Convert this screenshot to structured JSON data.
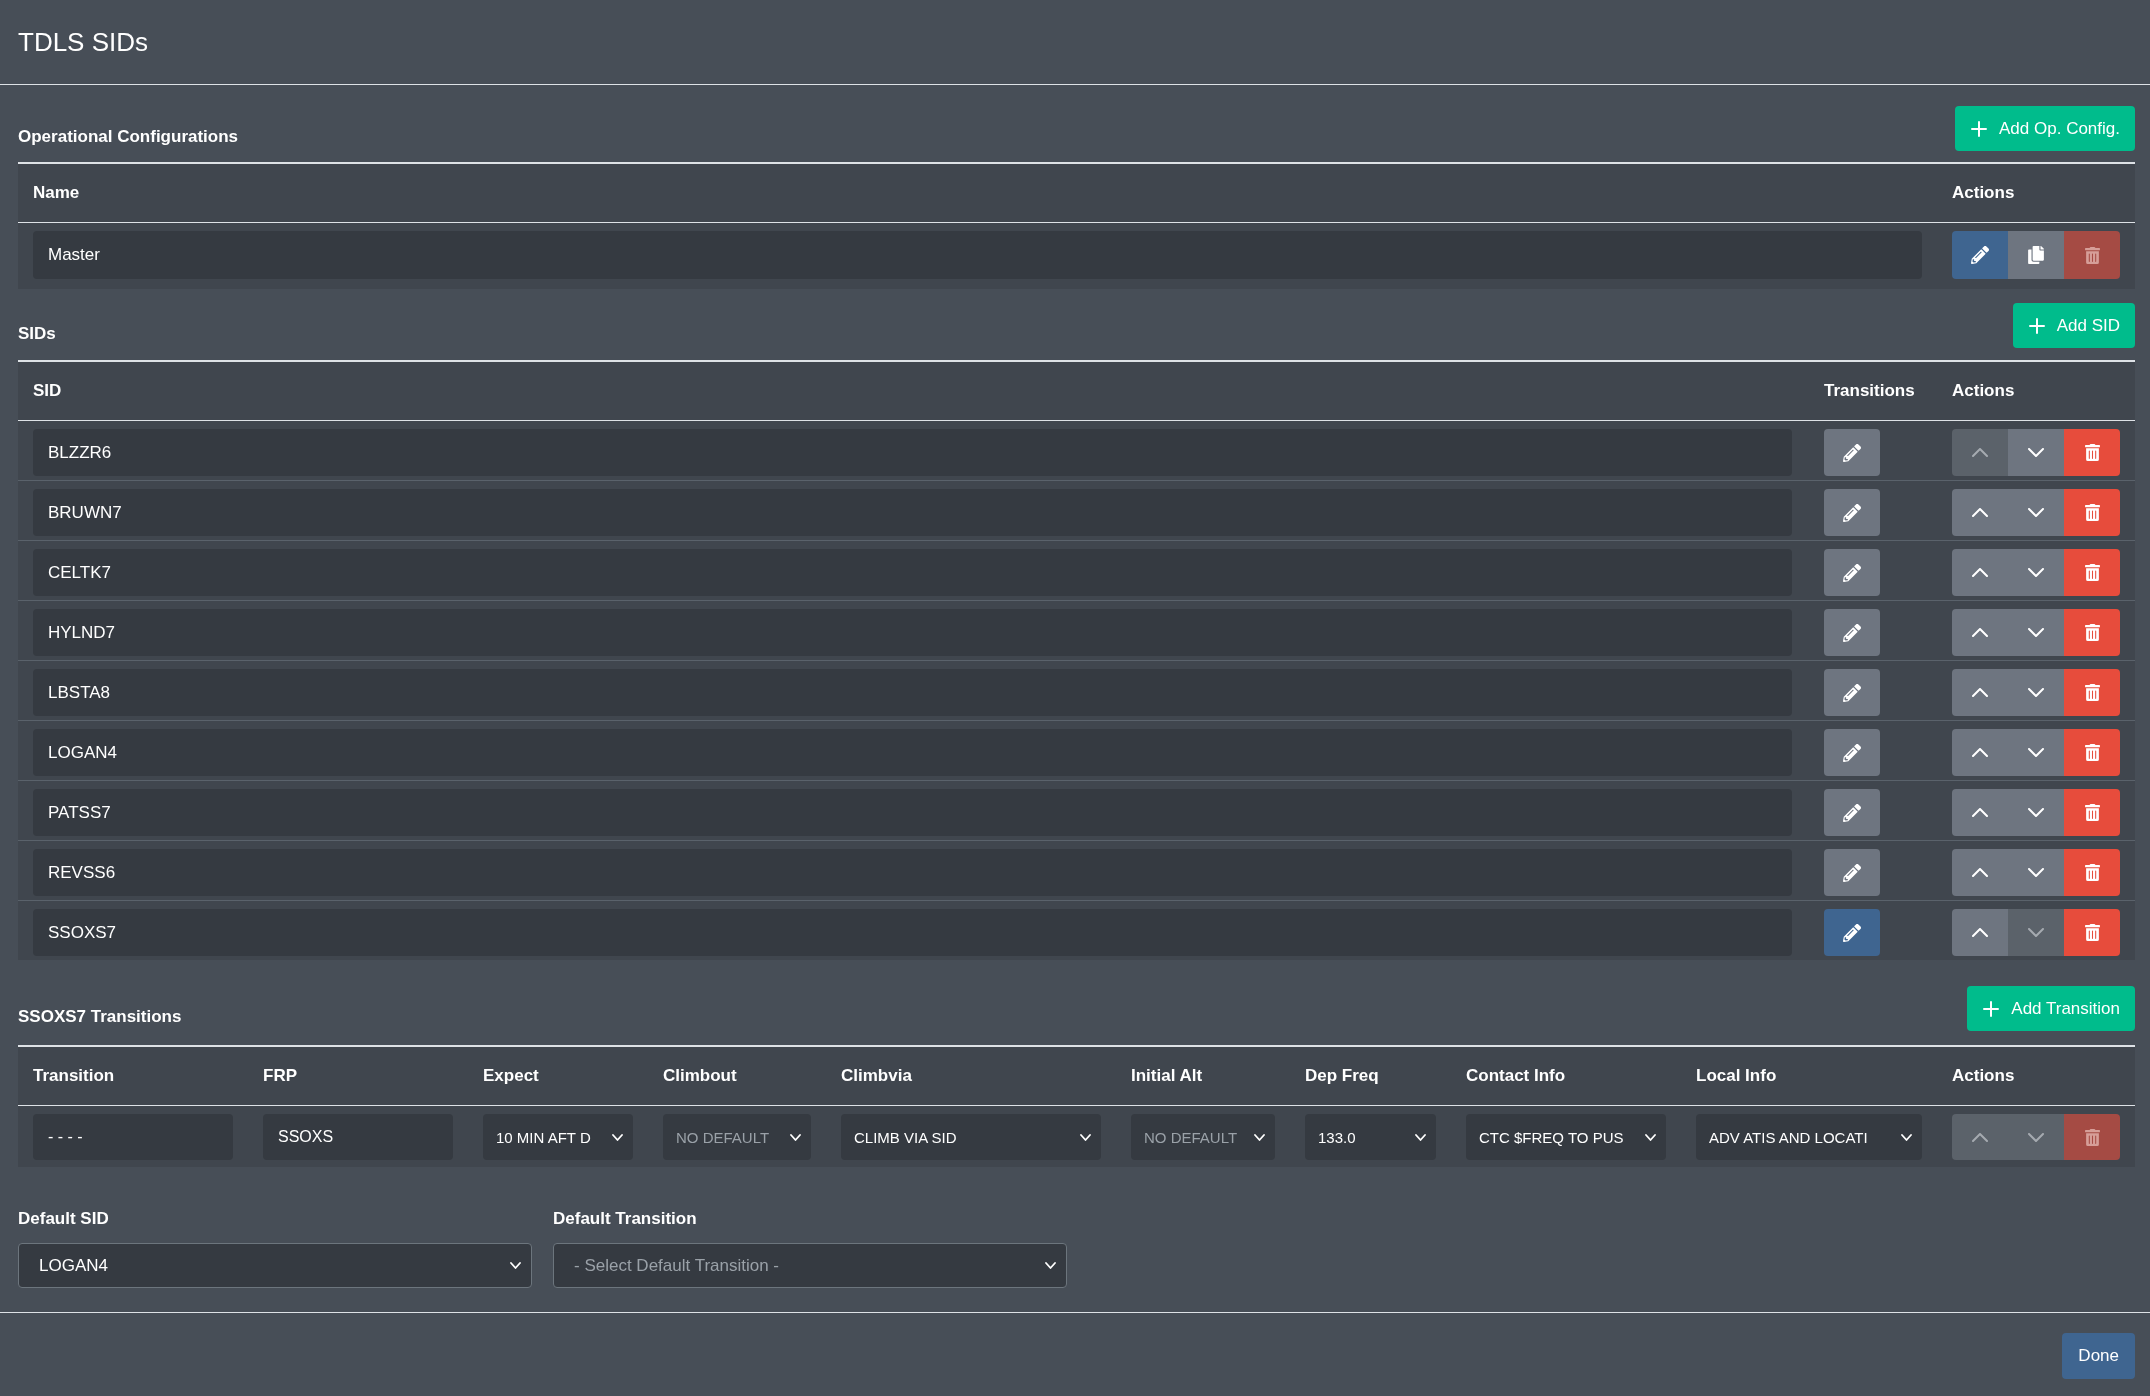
{
  "window": {
    "title": "TDLS SIDs"
  },
  "operational_configurations": {
    "title": "Operational Configurations",
    "add_button": "Add Op. Config.",
    "columns": [
      "Name",
      "Actions"
    ],
    "rows": [
      {
        "name": "Master",
        "delete_disabled": true
      }
    ]
  },
  "sids": {
    "title": "SIDs",
    "add_button": "Add SID",
    "columns": [
      "SID",
      "Transitions",
      "Actions"
    ],
    "rows": [
      {
        "name": "BLZZR6",
        "selected": false,
        "up_disabled": true,
        "down_disabled": false
      },
      {
        "name": "BRUWN7",
        "selected": false,
        "up_disabled": false,
        "down_disabled": false
      },
      {
        "name": "CELTK7",
        "selected": false,
        "up_disabled": false,
        "down_disabled": false
      },
      {
        "name": "HYLND7",
        "selected": false,
        "up_disabled": false,
        "down_disabled": false
      },
      {
        "name": "LBSTA8",
        "selected": false,
        "up_disabled": false,
        "down_disabled": false
      },
      {
        "name": "LOGAN4",
        "selected": false,
        "up_disabled": false,
        "down_disabled": false
      },
      {
        "name": "PATSS7",
        "selected": false,
        "up_disabled": false,
        "down_disabled": false
      },
      {
        "name": "REVSS6",
        "selected": false,
        "up_disabled": false,
        "down_disabled": false
      },
      {
        "name": "SSOXS7",
        "selected": true,
        "up_disabled": false,
        "down_disabled": true
      }
    ]
  },
  "transitions": {
    "title": "SSOXS7 Transitions",
    "add_button": "Add Transition",
    "columns": [
      "Transition",
      "FRP",
      "Expect",
      "Climbout",
      "Climbvia",
      "Initial Alt",
      "Dep Freq",
      "Contact Info",
      "Local Info",
      "Actions"
    ],
    "rows": [
      {
        "cells": [
          {
            "kind": "text",
            "value": "- - - -"
          },
          {
            "kind": "text",
            "value": "SSOXS"
          },
          {
            "kind": "select",
            "value": "10 MIN AFT D"
          },
          {
            "kind": "select",
            "placeholder": "NO DEFAULT"
          },
          {
            "kind": "select",
            "value": "CLIMB VIA SID"
          },
          {
            "kind": "select",
            "placeholder": "NO DEFAULT"
          },
          {
            "kind": "select",
            "value": "133.0"
          },
          {
            "kind": "select",
            "value": "CTC $FREQ TO PUS"
          },
          {
            "kind": "select",
            "value": "ADV ATIS AND LOCATI"
          }
        ],
        "up_disabled": true,
        "down_disabled": true,
        "delete_disabled": true
      }
    ]
  },
  "defaults": [
    {
      "label": "Default SID",
      "value": "LOGAN4"
    },
    {
      "label": "Default Transition",
      "placeholder": "- Select Default Transition -"
    }
  ],
  "done_button": "Done"
}
